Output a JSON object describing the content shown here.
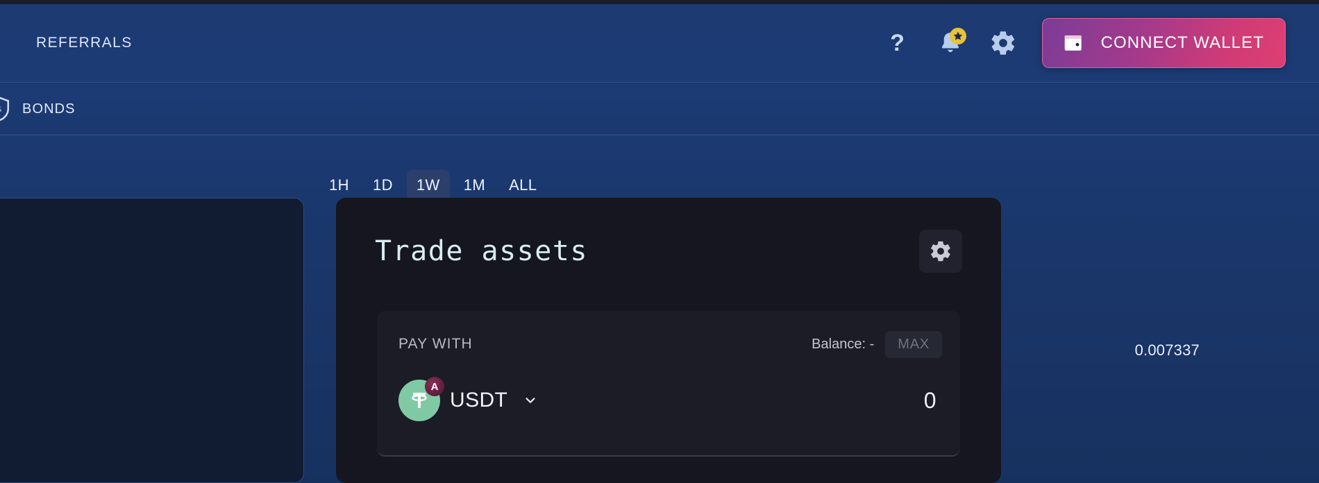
{
  "topbar": {
    "nav_items": [
      {
        "label": "REFERRALS",
        "name": "nav-item-referrals"
      }
    ],
    "actions": [
      {
        "name": "help-icon",
        "glyph": "?"
      },
      {
        "name": "notifications-bell-icon",
        "badge": "star"
      },
      {
        "name": "settings-gear-icon"
      }
    ],
    "connect_wallet": {
      "label": "CONNECT WALLET",
      "icon": "wallet-icon",
      "gradient_from": "#7b3c97",
      "gradient_to": "#dd3f72"
    }
  },
  "subnav": {
    "items": [
      {
        "label": "BONDS",
        "icon": "shield-bond-icon"
      }
    ]
  },
  "chart_panel": {
    "ranges": [
      {
        "label": "1H",
        "selected": false
      },
      {
        "label": "1D",
        "selected": false
      },
      {
        "label": "1W",
        "selected": true
      },
      {
        "label": "1M",
        "selected": false
      },
      {
        "label": "ALL",
        "selected": false
      }
    ],
    "value_label": "0.007337"
  },
  "trade_panel": {
    "title": "Trade assets",
    "settings_icon": "gear-icon",
    "pay_with": {
      "label": "PAY WITH",
      "balance_label": "Balance:",
      "balance_value": "-",
      "max_label": "MAX",
      "token": {
        "symbol": "USDT",
        "icon": "tether-icon",
        "chain_badge": "A",
        "chain_badge_name": "avalanche-badge-icon"
      },
      "amount_value": "0",
      "amount_placeholder": "0"
    }
  },
  "colors": {
    "background_top": "#16306b",
    "background_bottom": "#17315f",
    "panel_dark": "#15161f",
    "panel_inner": "#1b1c26",
    "accent_pink": "#dd3f72",
    "accent_purple": "#7b3c97",
    "token_green": "#7fcaa5",
    "badge_yellow": "#e8c33a",
    "title_cyan": "#d9ecf3"
  }
}
